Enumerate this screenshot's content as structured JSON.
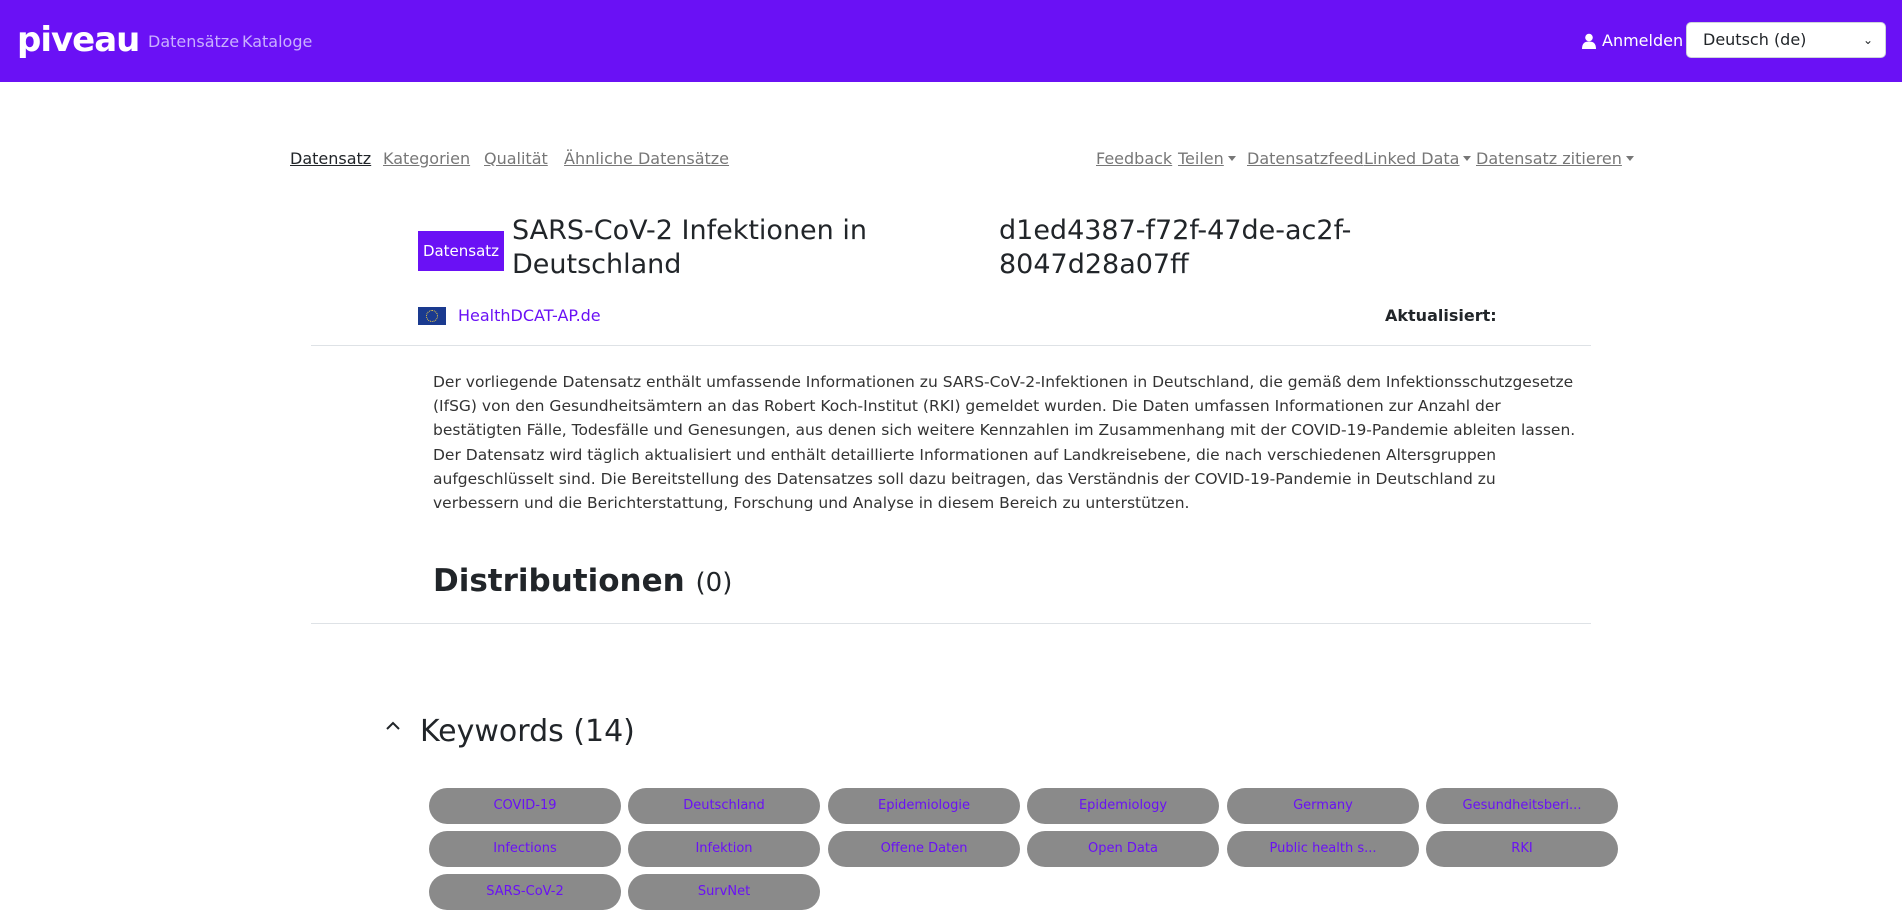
{
  "header": {
    "logo": "piveau",
    "nav": [
      "Datensätze",
      "Kataloge"
    ],
    "login_label": "Anmelden",
    "language": "Deutsch (de)"
  },
  "subnav": {
    "left": [
      "Datensatz",
      "Kategorien",
      "Qualität",
      "Ähnliche Datensätze"
    ],
    "right": [
      "Feedback",
      "Teilen",
      "Datensatzfeed",
      "Linked Data",
      "Datensatz zitieren"
    ]
  },
  "dataset": {
    "badge": "Datensatz",
    "title": "SARS-CoV-2 Infektionen in Deutschland",
    "id": "d1ed4387-f72f-47de-ac2f-8047d28a07ff",
    "catalog": "HealthDCAT-AP.de",
    "updated_label": "Aktualisiert:",
    "description": "Der vorliegende Datensatz enthält umfassende Informationen zu SARS-CoV-2-Infektionen in Deutschland, die gemäß dem Infektionsschutzgesetze (IfSG) von den Gesundheitsämtern an das Robert Koch-Institut (RKI) gemeldet wurden. Die Daten umfassen Informationen zur Anzahl der bestätigten Fälle, Todesfälle und Genesungen, aus denen sich weitere Kennzahlen im Zusammenhang mit der COVID-19-Pandemie ableiten lassen. Der Datensatz wird täglich aktualisiert und enthält detaillierte Informationen auf Landkreisebene, die nach verschiedenen Altersgruppen aufgeschlüsselt sind. Die Bereitstellung des Datensatzes soll dazu beitragen, das Verständnis der COVID-19-Pandemie in Deutschland zu verbessern und die Berichterstattung, Forschung und Analyse in diesem Bereich zu unterstützen."
  },
  "distributions": {
    "label": "Distributionen",
    "count": "(0)"
  },
  "keywords": {
    "label": "Keywords (14)",
    "items": [
      "COVID-19",
      "Deutschland",
      "Epidemiologie",
      "Epidemiology",
      "Germany",
      "Gesundheitsberi...",
      "Infections",
      "Infektion",
      "Offene Daten",
      "Open Data",
      "Public health s...",
      "RKI",
      "SARS-CoV-2",
      "SurvNet"
    ]
  },
  "colors": {
    "brand": "#6a11f5",
    "chip_bg": "#8a8a8a"
  }
}
